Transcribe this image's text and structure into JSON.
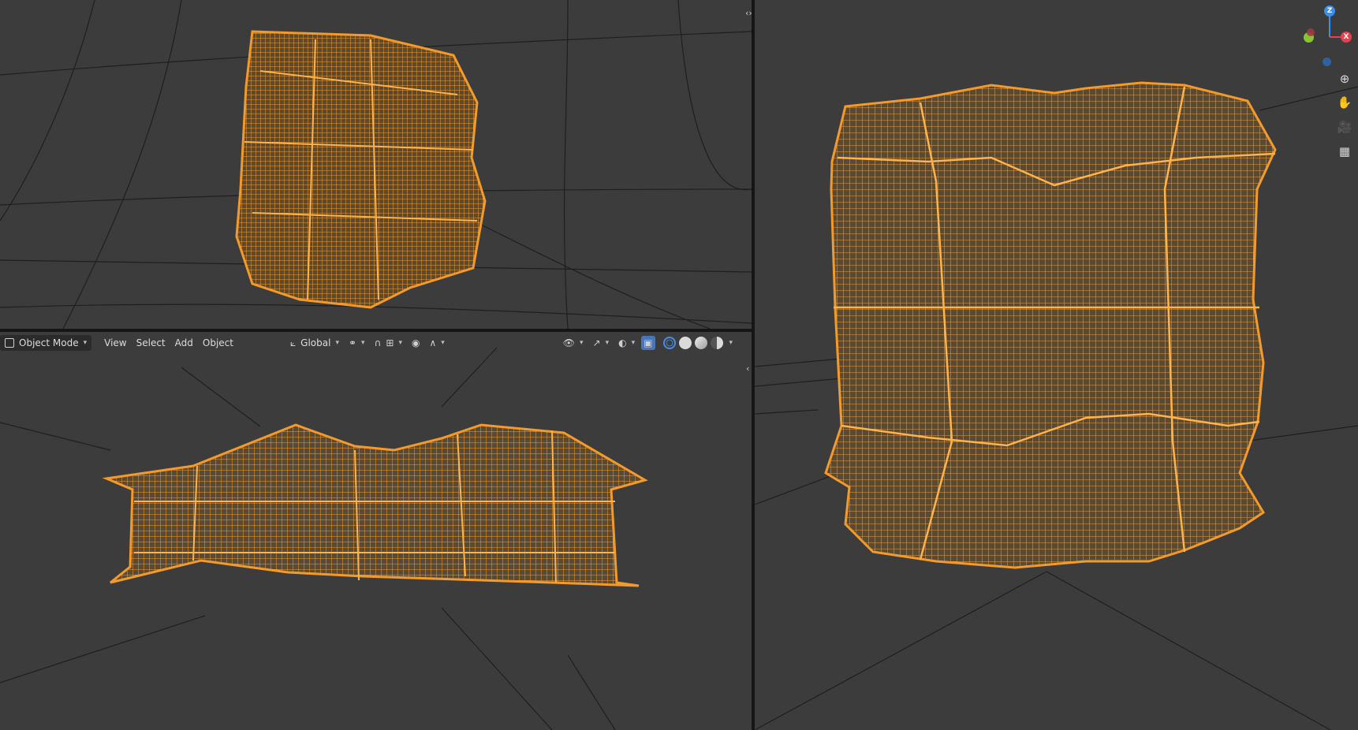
{
  "header": {
    "mode": "Object Mode",
    "menus": [
      "View",
      "Select",
      "Add",
      "Object"
    ],
    "transform_orientation": "Global"
  },
  "gizmo": {
    "z": "Z",
    "x": "X",
    "y": "Y"
  },
  "icons": {
    "mode": "object-mode-icon",
    "orientation": "orientation-axes-icon",
    "pivot": "pivot-link-icon",
    "snap": "snap-magnet-icon",
    "snap_target": "snap-increment-icon",
    "proportional": "proportional-edit-icon",
    "falloff": "falloff-curve-icon",
    "visibility": "eye-visibility-icon",
    "gizmo_toggle": "gizmo-toggle-icon",
    "overlay": "overlay-icon",
    "xray": "xray-toggle-icon",
    "zoom": "zoom-icon",
    "pan": "hand-pan-icon",
    "camera": "camera-view-icon",
    "grid": "perspective-grid-icon"
  },
  "colors": {
    "viewport_bg": "#3c3c3c",
    "wire": "#f39a2b",
    "axis_x": "#e8404f",
    "axis_y": "#8ac52f",
    "axis_z": "#3a8fe8"
  }
}
